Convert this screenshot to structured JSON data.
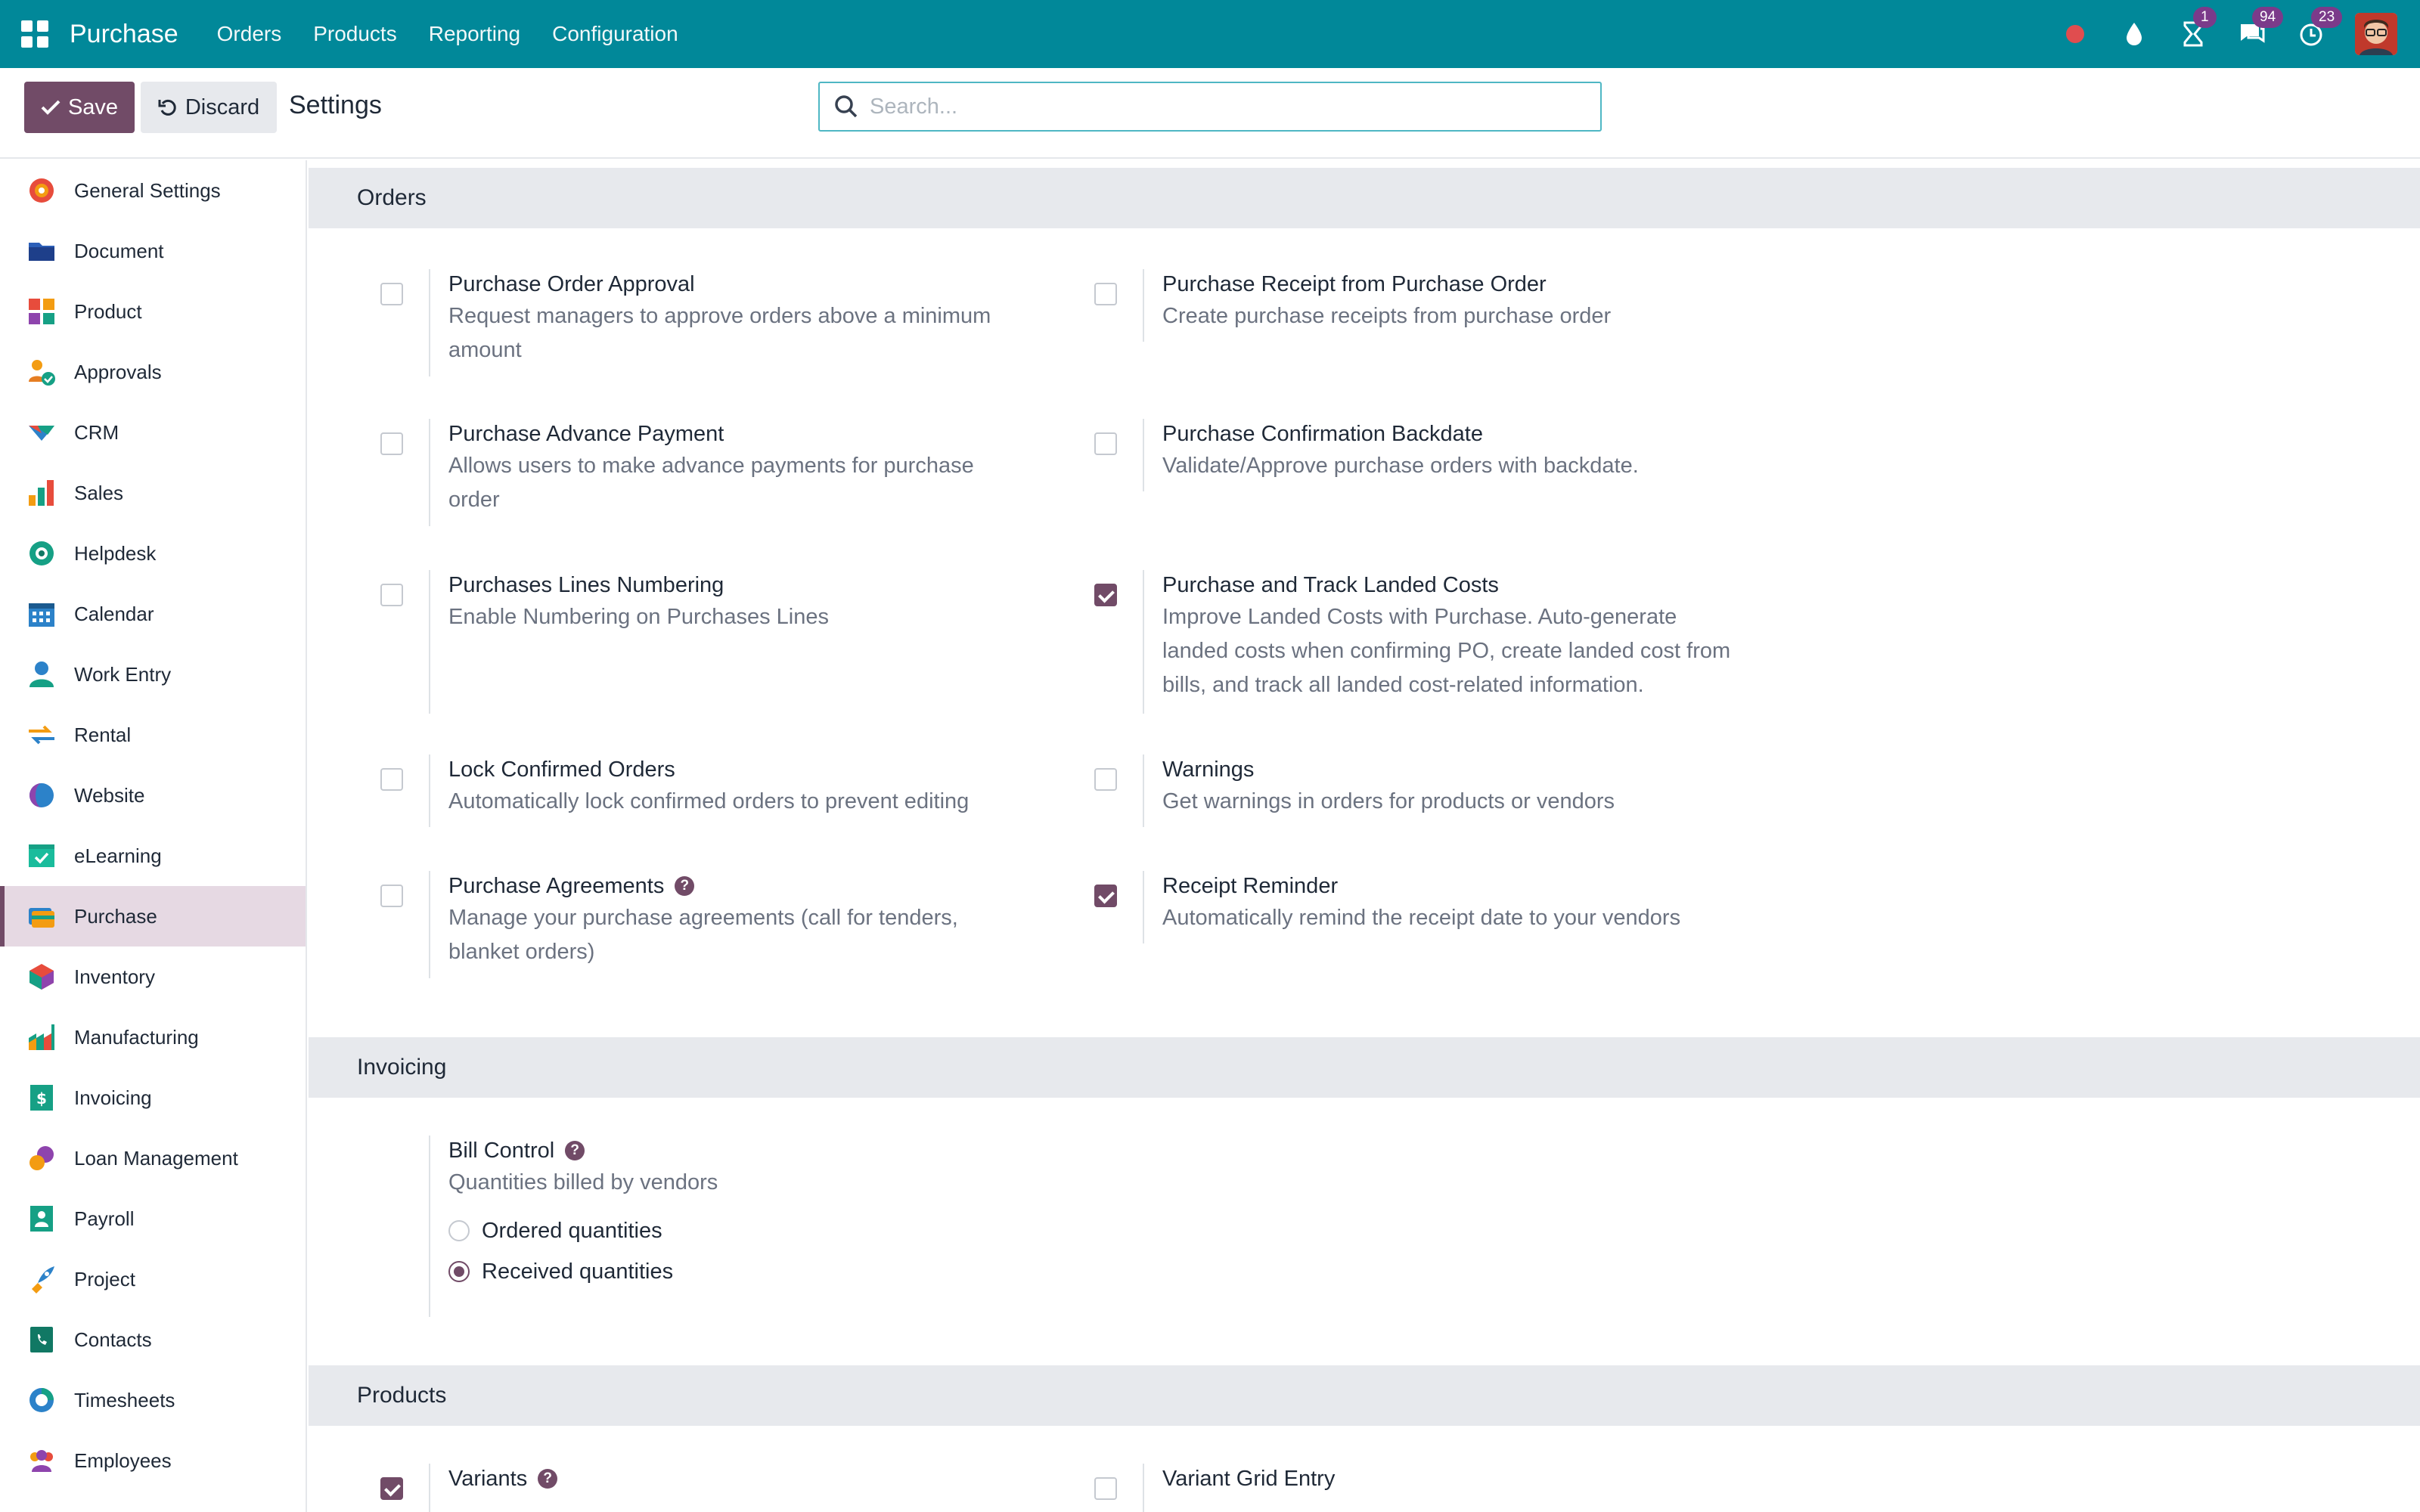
{
  "navbar": {
    "app_name": "Purchase",
    "menu": [
      "Orders",
      "Products",
      "Reporting",
      "Configuration"
    ],
    "activity_count": "1",
    "messages_count": "94",
    "timer_count": "23"
  },
  "control": {
    "save_label": "Save",
    "discard_label": "Discard",
    "title": "Settings",
    "search_placeholder": "Search..."
  },
  "sidebar": {
    "items": [
      {
        "label": "General Settings",
        "icon": "general-settings-icon"
      },
      {
        "label": "Document",
        "icon": "document-icon"
      },
      {
        "label": "Product",
        "icon": "product-icon"
      },
      {
        "label": "Approvals",
        "icon": "approvals-icon"
      },
      {
        "label": "CRM",
        "icon": "crm-icon"
      },
      {
        "label": "Sales",
        "icon": "sales-icon"
      },
      {
        "label": "Helpdesk",
        "icon": "helpdesk-icon"
      },
      {
        "label": "Calendar",
        "icon": "calendar-icon"
      },
      {
        "label": "Work Entry",
        "icon": "work-entry-icon"
      },
      {
        "label": "Rental",
        "icon": "rental-icon"
      },
      {
        "label": "Website",
        "icon": "website-icon"
      },
      {
        "label": "eLearning",
        "icon": "elearning-icon"
      },
      {
        "label": "Purchase",
        "icon": "purchase-icon",
        "active": true
      },
      {
        "label": "Inventory",
        "icon": "inventory-icon"
      },
      {
        "label": "Manufacturing",
        "icon": "manufacturing-icon"
      },
      {
        "label": "Invoicing",
        "icon": "invoicing-icon"
      },
      {
        "label": "Loan Management",
        "icon": "loan-management-icon"
      },
      {
        "label": "Payroll",
        "icon": "payroll-icon"
      },
      {
        "label": "Project",
        "icon": "project-icon"
      },
      {
        "label": "Contacts",
        "icon": "contacts-icon"
      },
      {
        "label": "Timesheets",
        "icon": "timesheets-icon"
      },
      {
        "label": "Employees",
        "icon": "employees-icon"
      }
    ]
  },
  "orders": {
    "heading": "Orders",
    "settings": [
      {
        "title": "Purchase Order Approval",
        "desc": [
          "Request managers to approve orders above a minimum",
          "amount"
        ],
        "checked": false
      },
      {
        "title": "Purchase Receipt from Purchase Order",
        "desc": [
          "Create purchase receipts from purchase order"
        ],
        "checked": false
      },
      {
        "title": "Purchase Advance Payment",
        "desc": [
          "Allows users to make advance payments for purchase",
          "order"
        ],
        "checked": false
      },
      {
        "title": "Purchase Confirmation Backdate",
        "desc": [
          "Validate/Approve purchase orders with backdate."
        ],
        "checked": false
      },
      {
        "title": "Purchases Lines Numbering",
        "desc": [
          "Enable Numbering on Purchases Lines"
        ],
        "checked": false
      },
      {
        "title": "Purchase and Track Landed Costs",
        "desc": [
          "Improve Landed Costs with Purchase. Auto-generate",
          "landed costs when confirming PO, create landed cost from",
          "bills, and track all landed cost-related information."
        ],
        "checked": true
      },
      {
        "title": "Lock Confirmed Orders",
        "desc": [
          "Automatically lock confirmed orders to prevent editing"
        ],
        "checked": false
      },
      {
        "title": "Warnings",
        "desc": [
          "Get warnings in orders for products or vendors"
        ],
        "checked": false
      },
      {
        "title": "Purchase Agreements",
        "desc": [
          "Manage your purchase agreements (call for tenders,",
          "blanket orders)"
        ],
        "checked": false,
        "help": true
      },
      {
        "title": "Receipt Reminder",
        "desc": [
          "Automatically remind the receipt date to your vendors"
        ],
        "checked": true
      }
    ]
  },
  "invoicing": {
    "heading": "Invoicing",
    "bill_control_title": "Bill Control",
    "bill_control_desc": "Quantities billed by vendors",
    "options": [
      "Ordered quantities",
      "Received quantities"
    ],
    "selected": "Received quantities"
  },
  "products": {
    "heading": "Products",
    "settings": [
      {
        "title": "Variants",
        "checked": true,
        "help": true
      },
      {
        "title": "Variant Grid Entry",
        "checked": false
      }
    ]
  }
}
